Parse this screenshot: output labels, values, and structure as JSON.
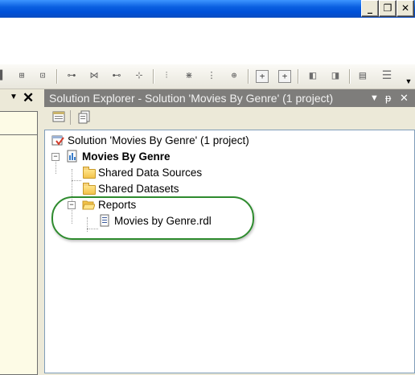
{
  "window": {
    "buttons": [
      {
        "name": "minimize",
        "glyph": "_"
      },
      {
        "name": "restore",
        "glyph": "❐"
      },
      {
        "name": "close",
        "glyph": "✕"
      }
    ]
  },
  "left_pane": {
    "pin_glyph": "▼",
    "close_glyph": "✕"
  },
  "solution_explorer": {
    "title": "Solution Explorer - Solution 'Movies By Genre' (1 project)",
    "header_icons": {
      "dropdown": "▼",
      "pin": "ᵽ",
      "close": "✕"
    },
    "tree": {
      "solution": "Solution 'Movies By Genre' (1 project)",
      "project": "Movies By Genre",
      "folders": [
        "Shared Data Sources",
        "Shared Datasets",
        "Reports"
      ],
      "report_file": "Movies by Genre.rdl",
      "expander_minus": "−"
    }
  },
  "colors": {
    "highlight_ring": "#2e8b2e",
    "title_bar_blue": "#0a5fe0",
    "panel_title_gray": "#7e7d7b"
  }
}
